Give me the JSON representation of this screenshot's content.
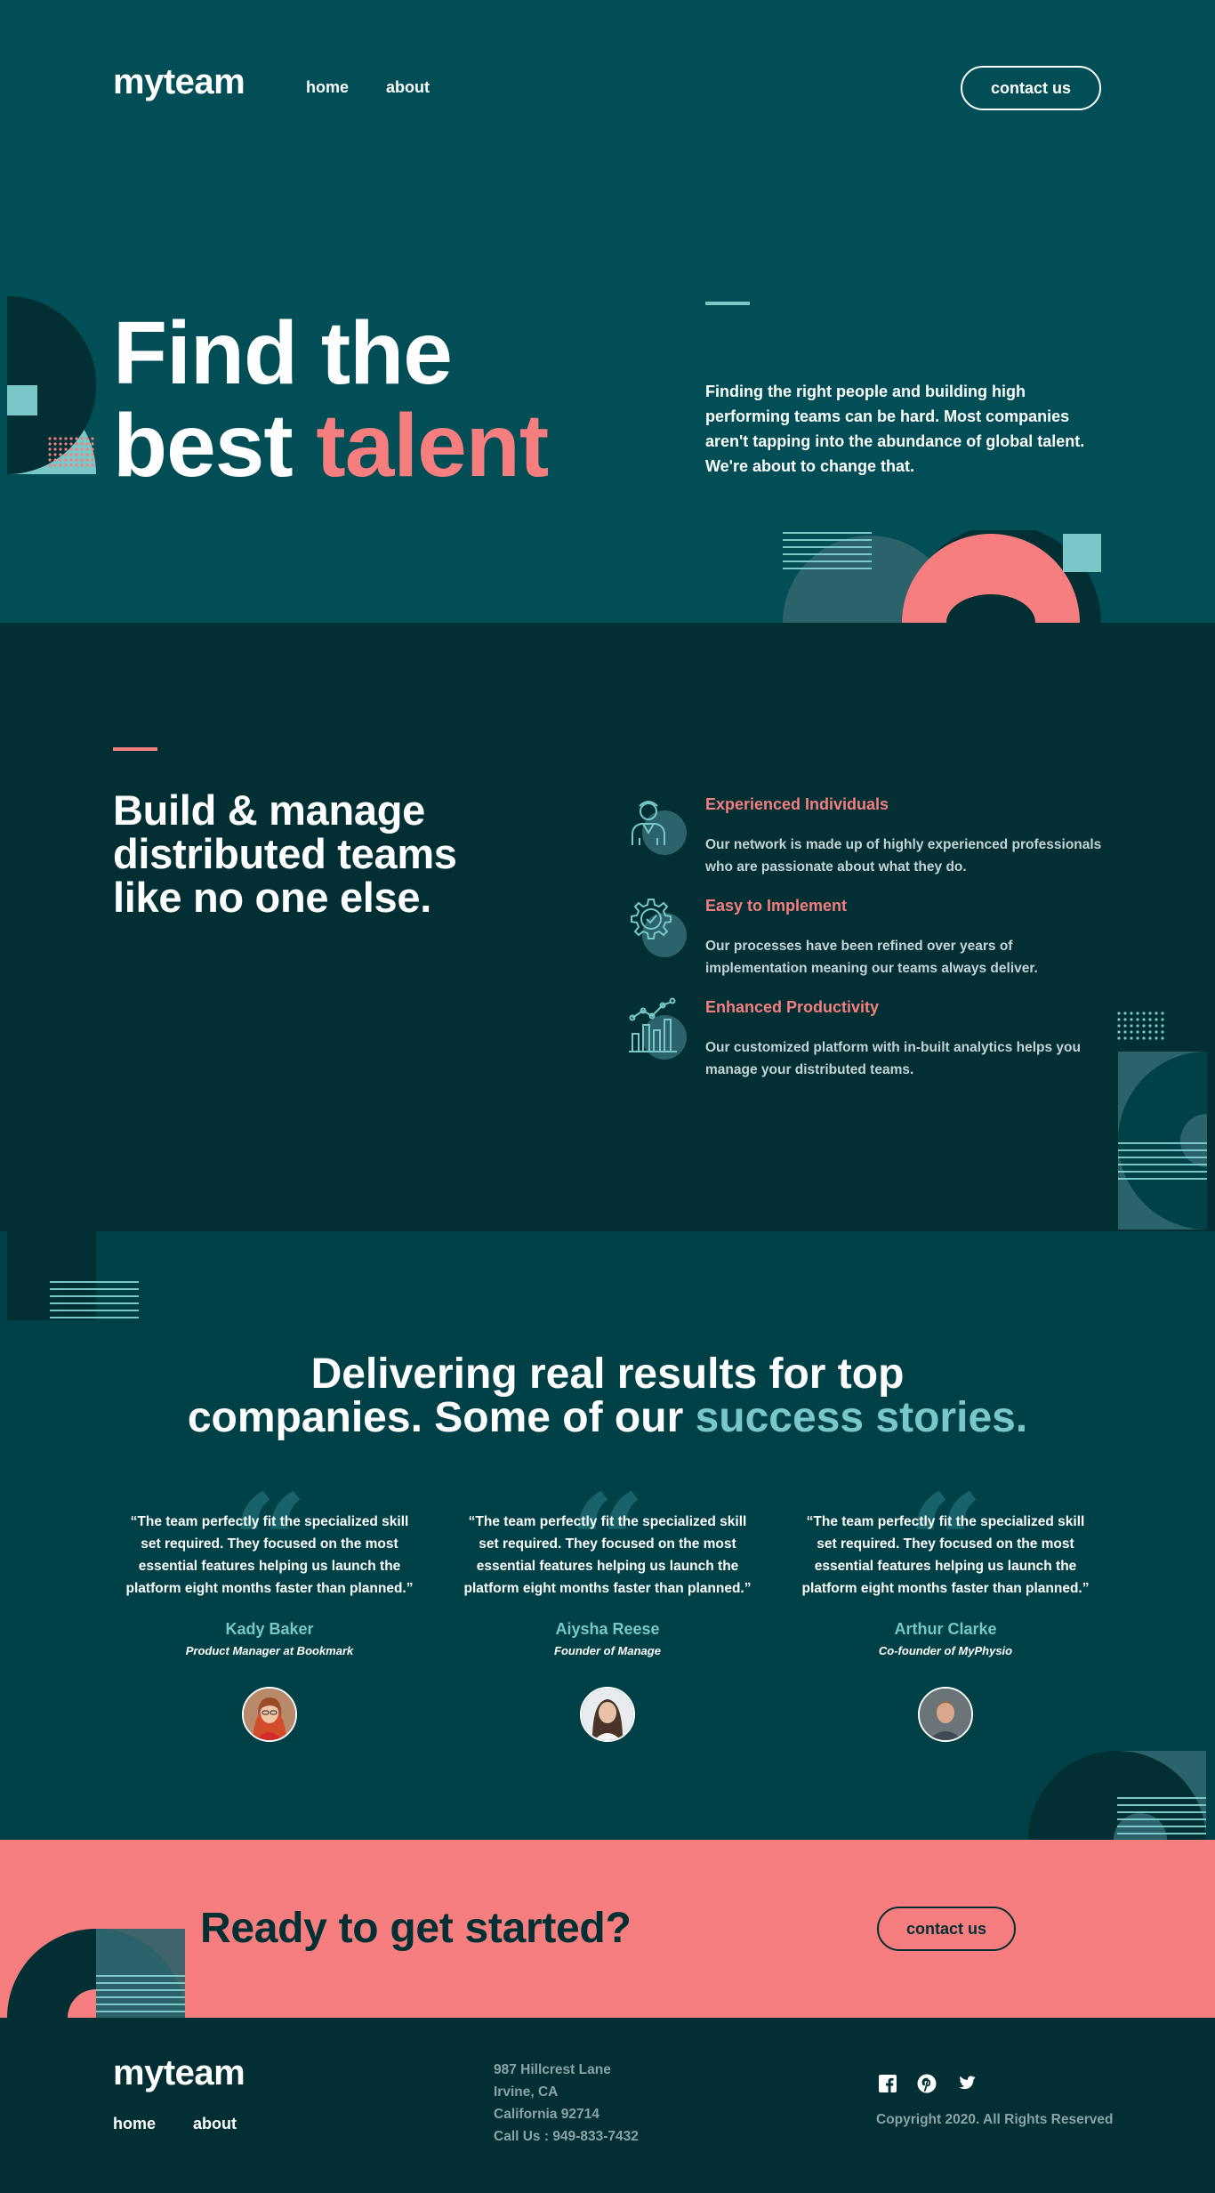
{
  "header": {
    "logo": "myteam",
    "nav": [
      {
        "label": "home"
      },
      {
        "label": "about"
      }
    ],
    "contact_label": "contact us"
  },
  "hero": {
    "title_line1": "Find the",
    "title_line2_a": "best",
    "title_line2_b": "talent",
    "description": "Finding the right people and building high performing teams can be hard. Most companies aren't tapping into the abundance of global talent. We're about to change that."
  },
  "features": {
    "title": "Build & manage distributed teams like no one else.",
    "items": [
      {
        "icon": "person-icon",
        "title": "Experienced Individuals",
        "text": "Our network is made up of highly experienced professionals who are passionate about what they do."
      },
      {
        "icon": "cog-check-icon",
        "title": "Easy to Implement",
        "text": "Our processes have been refined over years of implementation meaning our teams always deliver."
      },
      {
        "icon": "chart-icon",
        "title": "Enhanced Productivity",
        "text": "Our customized platform with in-built analytics helps you manage your distributed teams."
      }
    ]
  },
  "testimonials": {
    "title_a": "Delivering real results for top",
    "title_b": "companies. Some of our",
    "title_highlight": "success stories.",
    "items": [
      {
        "quote": "“The team perfectly fit the specialized skill set required. They focused on the most essential features helping us launch the platform eight months faster than planned.”",
        "name": "Kady Baker",
        "role": "Product Manager at Bookmark"
      },
      {
        "quote": "“The team perfectly fit the specialized skill set required. They focused on the most essential features helping us launch the platform eight months faster than planned.”",
        "name": "Aiysha Reese",
        "role": "Founder of Manage"
      },
      {
        "quote": "“The team perfectly fit the specialized skill set required. They focused on the most essential features helping us launch the platform eight months faster than planned.”",
        "name": "Arthur Clarke",
        "role": "Co-founder of MyPhysio"
      }
    ]
  },
  "cta": {
    "title": "Ready to get started?",
    "button_label": "contact us"
  },
  "footer": {
    "logo": "myteam",
    "nav": [
      {
        "label": "home"
      },
      {
        "label": "about"
      }
    ],
    "address": [
      "987 Hillcrest Lane",
      "Irvine, CA",
      "California 92714",
      "Call Us : 949-833-7432"
    ],
    "social": [
      "facebook-icon",
      "pinterest-icon",
      "twitter-icon"
    ],
    "copyright": "Copyright 2020. All Rights Reserved"
  },
  "colors": {
    "hero_bg": "#014e56",
    "dark_bg": "#012f34",
    "testimonial_bg": "#004047",
    "coral": "#f67e7e",
    "teal": "#79c8c7",
    "light_teal": "#c6d3d4"
  }
}
